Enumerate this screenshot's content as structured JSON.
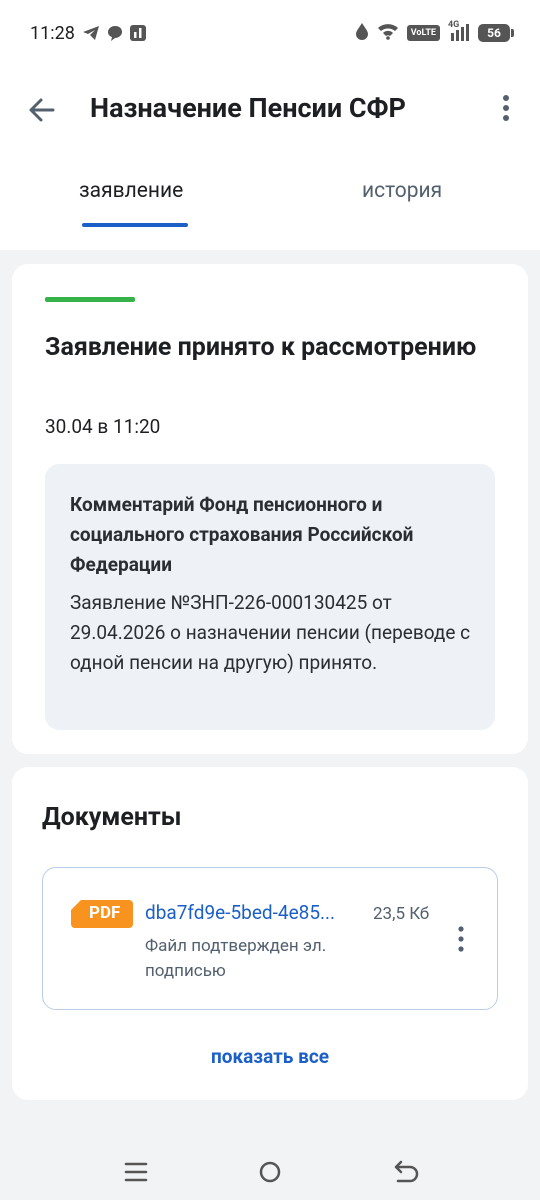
{
  "status_bar": {
    "time": "11:28",
    "network_label": "VoLTE",
    "signal_label": "4G",
    "battery_level": "56",
    "icons": [
      "telegram-icon",
      "chat-icon",
      "app-icon",
      "drop-icon",
      "wifi-icon",
      "signal-icon",
      "battery-icon"
    ]
  },
  "header": {
    "title": "Назначение Пенсии СФР"
  },
  "tabs": [
    {
      "label": "заявление",
      "active": true
    },
    {
      "label": "история",
      "active": false
    }
  ],
  "status_card": {
    "title": "Заявление принято к рассмотрению",
    "date": "30.04 в 11:20",
    "progress_color": "#35b34a",
    "comment": {
      "title": "Комментарий Фонд пенсионного и социального страхования Российской Федерации",
      "text": "Заявление №ЗНП-226-000130425 от 29.04.2026 о назначении пенсии (переводе с одной пенсии на другую) принято."
    }
  },
  "documents_card": {
    "title": "Документы",
    "documents": [
      {
        "type_label": "PDF",
        "name": "dba7fd9e-5bed-4e85...",
        "size": "23,5 Кб",
        "note": "Файл подтвержден эл. подписью"
      }
    ],
    "show_all_label": "показать все"
  },
  "colors": {
    "accent": "#1b5fc7",
    "success": "#35b34a",
    "pdf_badge": "#f7931e"
  }
}
